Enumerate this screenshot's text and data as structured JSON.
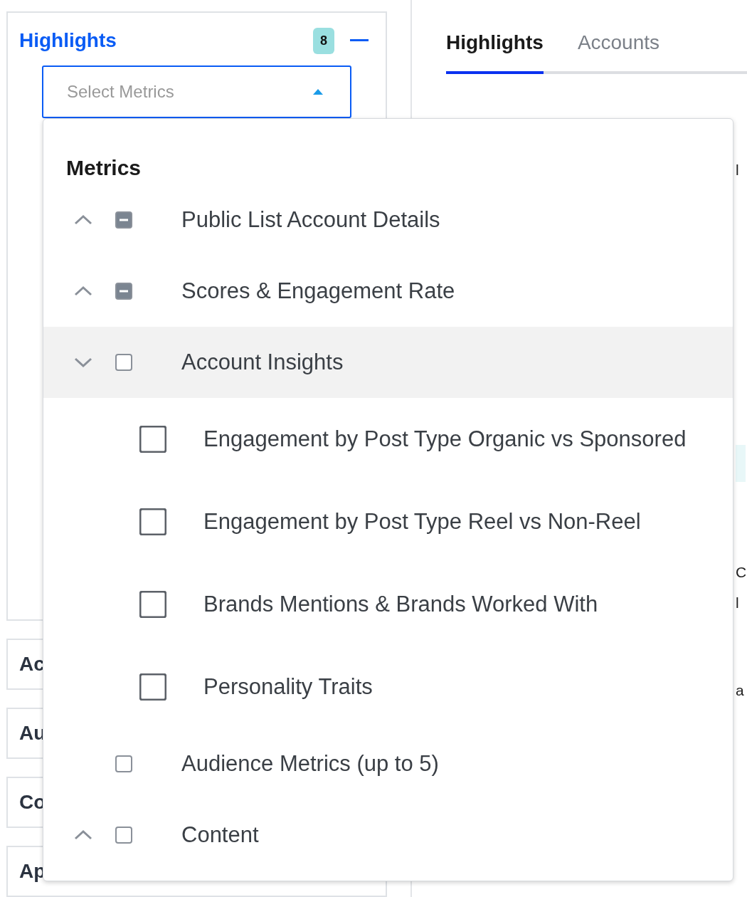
{
  "left_panel": {
    "title": "Highlights",
    "badge": "8",
    "select": {
      "placeholder": "Select Metrics",
      "open": true
    },
    "sections": [
      "Ac",
      "Au",
      "Co",
      "Ap"
    ]
  },
  "tabs": [
    {
      "label": "Highlights",
      "selected": true
    },
    {
      "label": "Accounts",
      "selected": false
    }
  ],
  "right_fragments": [
    {
      "text": "l",
      "kind": "text"
    },
    {
      "kind": "band"
    },
    {
      "text": "C",
      "kind": "text"
    },
    {
      "text": "l",
      "kind": "text"
    },
    {
      "text": "a",
      "kind": "text"
    }
  ],
  "dropdown": {
    "heading": "Metrics",
    "groups": [
      {
        "label": "Public List Account Details",
        "checked": false,
        "indeterminate": true,
        "expanded": false,
        "hovered": false
      },
      {
        "label": "Scores & Engagement Rate",
        "checked": false,
        "indeterminate": true,
        "expanded": false,
        "hovered": false
      },
      {
        "label": "Account Insights",
        "checked": false,
        "indeterminate": false,
        "expanded": true,
        "hovered": true,
        "children": [
          {
            "label": "Engagement by Post Type Organic vs Sponsored",
            "checked": false
          },
          {
            "label": "Engagement by Post Type Reel vs Non-Reel",
            "checked": false
          },
          {
            "label": "Brands Mentions & Brands Worked With",
            "checked": false
          },
          {
            "label": "Personality Traits",
            "checked": false
          }
        ]
      },
      {
        "label": "Audience Metrics (up to 5)",
        "checked": false,
        "indeterminate": false,
        "hovered": false
      },
      {
        "label": "Content",
        "checked": false,
        "indeterminate": false,
        "expanded": false,
        "hovered": false
      }
    ]
  }
}
